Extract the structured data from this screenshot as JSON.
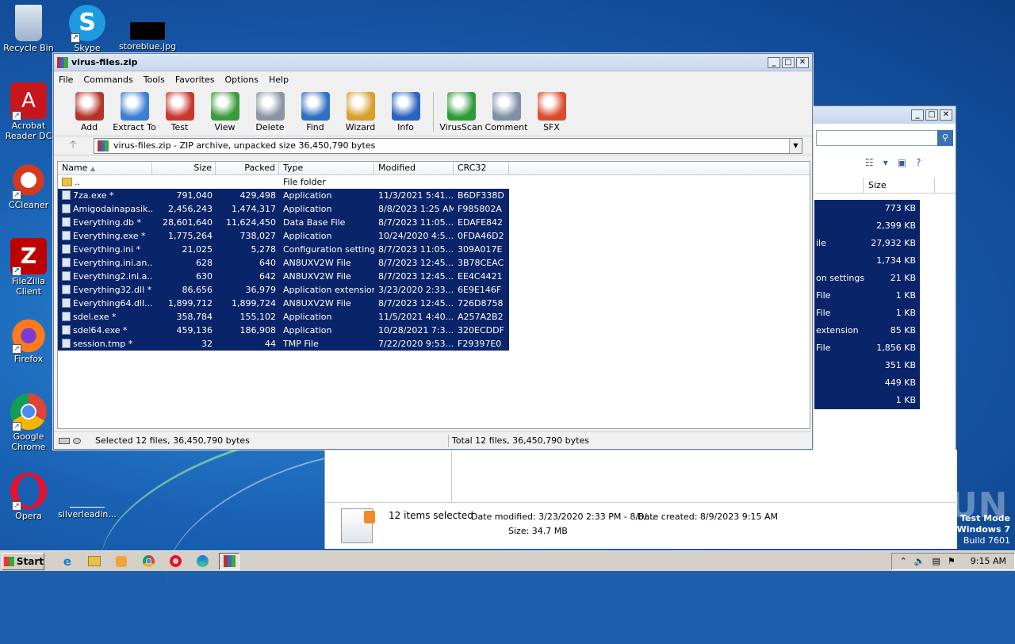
{
  "desktop": {
    "icons": [
      {
        "label": "Recycle Bin",
        "icon": "recycle-bin-icon"
      },
      {
        "label": "Skype",
        "icon": "skype-icon"
      },
      {
        "label": "storeblue.jpg",
        "icon": "image-file-icon"
      },
      {
        "label": "Acrobat Reader DC",
        "icon": "acrobat-icon"
      },
      {
        "label": "CCleaner",
        "icon": "ccleaner-icon"
      },
      {
        "label": "FileZilla Client",
        "icon": "filezilla-icon"
      },
      {
        "label": "Firefox",
        "icon": "firefox-icon"
      },
      {
        "label": "Google Chrome",
        "icon": "chrome-icon"
      },
      {
        "label": "Opera",
        "icon": "opera-icon"
      },
      {
        "label": "silverleadin...",
        "icon": "file-icon"
      }
    ],
    "watermark": "ANY RUN",
    "test_mode": {
      "line1": "Test Mode",
      "line2": "Windows 7",
      "line3": "Build 7601"
    }
  },
  "winrar": {
    "title": "virus-files.zip",
    "menu": [
      "File",
      "Commands",
      "Tools",
      "Favorites",
      "Options",
      "Help"
    ],
    "toolbar": [
      {
        "label": "Add",
        "icon": "add-archive-icon",
        "color": "#b5342a"
      },
      {
        "label": "Extract To",
        "icon": "extract-folder-icon",
        "color": "#3d7fd1"
      },
      {
        "label": "Test",
        "icon": "test-checklist-icon",
        "color": "#c8382c"
      },
      {
        "label": "View",
        "icon": "view-book-icon",
        "color": "#3b9a3b"
      },
      {
        "label": "Delete",
        "icon": "trash-icon",
        "color": "#8b95a3"
      },
      {
        "label": "Find",
        "icon": "magnifier-icon",
        "color": "#2f6fc4"
      },
      {
        "label": "Wizard",
        "icon": "wand-icon",
        "color": "#d6a12a"
      },
      {
        "label": "Info",
        "icon": "info-icon",
        "color": "#2b64c0"
      },
      {
        "label": "VirusScan",
        "icon": "virus-scan-icon",
        "color": "#2e9b3a"
      },
      {
        "label": "Comment",
        "icon": "comment-icon",
        "color": "#7f8fa6"
      },
      {
        "label": "SFX",
        "icon": "sfx-box-icon",
        "color": "#d94c2c"
      }
    ],
    "address": "virus-files.zip - ZIP archive, unpacked size 36,450,790 bytes",
    "columns": [
      "Name",
      "Size",
      "Packed",
      "Type",
      "Modified",
      "CRC32"
    ],
    "parent_row": {
      "name": "..",
      "type": "File folder"
    },
    "files": [
      {
        "name": "7za.exe *",
        "size": "791,040",
        "packed": "429,498",
        "type": "Application",
        "modified": "11/3/2021 5:41...",
        "crc": "B6DF338D"
      },
      {
        "name": "Amigodainapasik....",
        "size": "2,456,243",
        "packed": "1,474,317",
        "type": "Application",
        "modified": "8/8/2023 1:25 AM",
        "crc": "F985802A"
      },
      {
        "name": "Everything.db *",
        "size": "28,601,640",
        "packed": "11,624,450",
        "type": "Data Base File",
        "modified": "8/7/2023 11:05...",
        "crc": "EDAFE842"
      },
      {
        "name": "Everything.exe *",
        "size": "1,775,264",
        "packed": "738,027",
        "type": "Application",
        "modified": "10/24/2020 4:5...",
        "crc": "0FDA46D2"
      },
      {
        "name": "Everything.ini *",
        "size": "21,025",
        "packed": "5,278",
        "type": "Configuration settings",
        "modified": "8/7/2023 11:05...",
        "crc": "309A017E"
      },
      {
        "name": "Everything.ini.an...",
        "size": "628",
        "packed": "640",
        "type": "AN8UXV2W File",
        "modified": "8/7/2023 12:45...",
        "crc": "3B78CEAC"
      },
      {
        "name": "Everything2.ini.a...",
        "size": "630",
        "packed": "642",
        "type": "AN8UXV2W File",
        "modified": "8/7/2023 12:45...",
        "crc": "EE4C4421"
      },
      {
        "name": "Everything32.dll *",
        "size": "86,656",
        "packed": "36,979",
        "type": "Application extension",
        "modified": "3/23/2020 2:33...",
        "crc": "6E9E146F"
      },
      {
        "name": "Everything64.dll....",
        "size": "1,899,712",
        "packed": "1,899,724",
        "type": "AN8UXV2W File",
        "modified": "8/7/2023 12:45...",
        "crc": "726D8758"
      },
      {
        "name": "sdel.exe *",
        "size": "358,784",
        "packed": "155,102",
        "type": "Application",
        "modified": "11/5/2021 4:40...",
        "crc": "A257A2B2"
      },
      {
        "name": "sdel64.exe *",
        "size": "459,136",
        "packed": "186,908",
        "type": "Application",
        "modified": "10/28/2021 7:3...",
        "crc": "320ECDDF"
      },
      {
        "name": "session.tmp *",
        "size": "32",
        "packed": "44",
        "type": "TMP File",
        "modified": "7/22/2020 9:53...",
        "crc": "F29397E0"
      }
    ],
    "status_left": "Selected 12 files, 36,450,790 bytes",
    "status_right": "Total 12 files, 36,450,790 bytes"
  },
  "explorer": {
    "column_size": "Size",
    "rows": [
      {
        "type": "",
        "size": "773 KB"
      },
      {
        "type": "",
        "size": "2,399 KB"
      },
      {
        "type": "ile",
        "size": "27,932 KB"
      },
      {
        "type": "",
        "size": "1,734 KB"
      },
      {
        "type": "on settings",
        "size": "21 KB"
      },
      {
        "type": "File",
        "size": "1 KB"
      },
      {
        "type": "File",
        "size": "1 KB"
      },
      {
        "type": "extension",
        "size": "85 KB"
      },
      {
        "type": "File",
        "size": "1,856 KB"
      },
      {
        "type": "",
        "size": "351 KB"
      },
      {
        "type": "",
        "size": "449 KB"
      },
      {
        "type": "",
        "size": "1 KB"
      }
    ],
    "details": {
      "selected": "12 items selected",
      "date_modified": "Date modified: 3/23/2020 2:33 PM - 8/8/...",
      "date_created": "Date created: 8/9/2023 9:15 AM",
      "size": "Size: 34.7 MB"
    }
  },
  "taskbar": {
    "start": "Start",
    "apps": [
      "ie-icon",
      "explorer-icon",
      "media-player-icon",
      "chrome-icon",
      "opera-icon",
      "edge-icon",
      "winrar-icon"
    ],
    "clock": "9:15 AM"
  }
}
